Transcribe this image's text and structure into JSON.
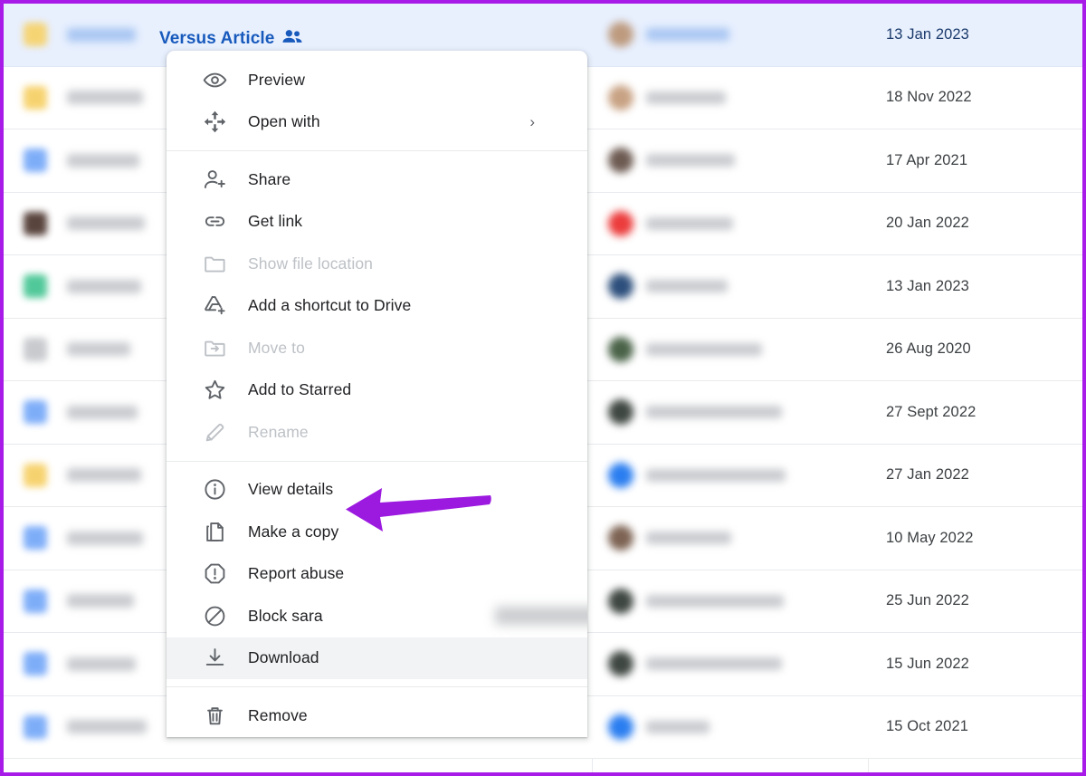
{
  "frame": {
    "border_color": "#a81ae8"
  },
  "selected_row": {
    "title": "Versus Article",
    "shared_icon": "people-shared-icon",
    "title_color": "#185abc"
  },
  "annotation": {
    "arrow_icon": "left-pointing-arrow",
    "color": "#9c1ae0",
    "points_at": "View details"
  },
  "file_list": {
    "columns": [
      "name",
      "owner",
      "last_modified"
    ],
    "rows": [
      {
        "icon_color": "#f7d269",
        "icon": "folder-icon",
        "name_width": 76,
        "avatar_color": "#bd9a7e",
        "owner_width": 92,
        "date": "13 Jan 2023",
        "selected": true
      },
      {
        "icon_color": "#f6cf63",
        "icon": "folder-icon",
        "name_width": 84,
        "avatar_color": "#c8a283",
        "owner_width": 88,
        "date": "18 Nov 2022",
        "selected": false
      },
      {
        "icon_color": "#74a7f8",
        "icon": "docs-icon",
        "name_width": 80,
        "avatar_color": "#6d5b52",
        "owner_width": 98,
        "date": "17 Apr 2021",
        "selected": false
      },
      {
        "icon_color": "#4b342d",
        "icon": "image-icon",
        "name_width": 86,
        "avatar_color": "#ec3c3c",
        "owner_width": 96,
        "date": "20 Jan 2022",
        "selected": false
      },
      {
        "icon_color": "#43c491",
        "icon": "sheets-icon",
        "name_width": 82,
        "avatar_color": "#2d4f7c",
        "owner_width": 90,
        "date": "13 Jan 2023",
        "selected": false
      },
      {
        "icon_color": "#c4c6ca",
        "icon": "generic-icon",
        "name_width": 70,
        "avatar_color": "#4a6348",
        "owner_width": 128,
        "date": "26 Aug 2020",
        "selected": false
      },
      {
        "icon_color": "#74a7f8",
        "icon": "docs-icon",
        "name_width": 78,
        "avatar_color": "#3f4742",
        "owner_width": 150,
        "date": "27 Sept 2022",
        "selected": false
      },
      {
        "icon_color": "#f6cf63",
        "icon": "folder-icon",
        "name_width": 82,
        "avatar_color": "#2b7ef0",
        "owner_width": 154,
        "date": "27 Jan 2022",
        "selected": false
      },
      {
        "icon_color": "#74a7f8",
        "icon": "docs-icon",
        "name_width": 84,
        "avatar_color": "#7d6353",
        "owner_width": 94,
        "date": "10 May 2022",
        "selected": false
      },
      {
        "icon_color": "#74a7f8",
        "icon": "docs-icon",
        "name_width": 74,
        "avatar_color": "#3f4742",
        "owner_width": 152,
        "date": "25 Jun 2022",
        "selected": false
      },
      {
        "icon_color": "#74a7f8",
        "icon": "docs-icon",
        "name_width": 76,
        "avatar_color": "#3f4742",
        "owner_width": 150,
        "date": "15 Jun 2022",
        "selected": false
      },
      {
        "icon_color": "#74a7f8",
        "icon": "docs-icon",
        "name_width": 88,
        "avatar_color": "#2b7ef0",
        "owner_width": 70,
        "date": "15 Oct 2021",
        "selected": false
      }
    ]
  },
  "context_menu": {
    "groups": [
      {
        "items": [
          {
            "icon": "eye-icon",
            "label": "Preview",
            "disabled": false,
            "hover": false,
            "submenu": false
          },
          {
            "icon": "move-arrows-icon",
            "label": "Open with",
            "disabled": false,
            "hover": false,
            "submenu": true,
            "submenu_arrow": "›"
          }
        ]
      },
      {
        "items": [
          {
            "icon": "person-add-icon",
            "label": "Share",
            "disabled": false,
            "hover": false,
            "submenu": false
          },
          {
            "icon": "link-icon",
            "label": "Get link",
            "disabled": false,
            "hover": false,
            "submenu": false
          },
          {
            "icon": "folder-icon",
            "label": "Show file location",
            "disabled": true,
            "hover": false,
            "submenu": false
          },
          {
            "icon": "drive-shortcut-icon",
            "label": "Add a shortcut to Drive",
            "disabled": false,
            "hover": false,
            "submenu": false
          },
          {
            "icon": "folder-move-icon",
            "label": "Move to",
            "disabled": true,
            "hover": false,
            "submenu": false
          },
          {
            "icon": "star-icon",
            "label": "Add to Starred",
            "disabled": false,
            "hover": false,
            "submenu": false
          },
          {
            "icon": "pencil-icon",
            "label": "Rename",
            "disabled": true,
            "hover": false,
            "submenu": false
          }
        ]
      },
      {
        "items": [
          {
            "icon": "info-circle-icon",
            "label": "View details",
            "disabled": false,
            "hover": false,
            "submenu": false
          },
          {
            "icon": "copy-icon",
            "label": "Make a copy",
            "disabled": false,
            "hover": false,
            "submenu": false
          },
          {
            "icon": "report-octagon-icon",
            "label": "Report abuse",
            "disabled": false,
            "hover": false,
            "submenu": false
          },
          {
            "icon": "block-icon",
            "label": "Block sara",
            "disabled": false,
            "hover": false,
            "submenu": false,
            "redacted_suffix": true
          },
          {
            "icon": "download-icon",
            "label": "Download",
            "disabled": false,
            "hover": true,
            "submenu": false
          }
        ]
      },
      {
        "items": [
          {
            "icon": "trash-icon",
            "label": "Remove",
            "disabled": false,
            "hover": false,
            "submenu": false
          }
        ]
      }
    ]
  }
}
